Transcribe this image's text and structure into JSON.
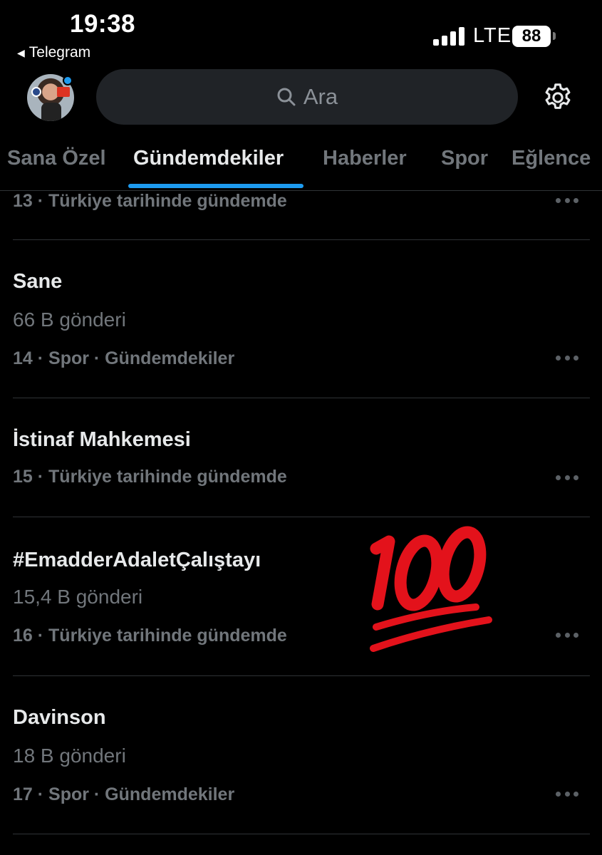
{
  "status_bar": {
    "time": "19:38",
    "back_app": "Telegram",
    "network": "LTE",
    "battery": "88"
  },
  "header": {
    "search_placeholder": "Ara"
  },
  "tabs": [
    {
      "label": "Sana Özel"
    },
    {
      "label": "Gündemdekiler",
      "active": true
    },
    {
      "label": "Haberler"
    },
    {
      "label": "Spor"
    },
    {
      "label": "Eğlence"
    }
  ],
  "trends": [
    {
      "meta": "13 · Türkiye tarihinde gündemde"
    },
    {
      "title": "Sane",
      "count": "66 B gönderi",
      "meta": "14 · Spor · Gündemdekiler"
    },
    {
      "title": "İstinaf Mahkemesi",
      "meta": "15 · Türkiye tarihinde gündemde"
    },
    {
      "title": "#EmadderAdaletÇalıştayı",
      "count": "15,4 B gönderi",
      "meta": "16 · Türkiye tarihinde gündemde"
    },
    {
      "title": "Davinson",
      "count": "18 B gönderi",
      "meta": "17 · Spor · Gündemdekiler"
    }
  ],
  "overlay": {
    "emoji": "100",
    "color": "#e3121b"
  },
  "colors": {
    "background": "#000000",
    "accent": "#1d9bf0",
    "text_primary": "#e7e9ea",
    "text_secondary": "#71767b"
  }
}
